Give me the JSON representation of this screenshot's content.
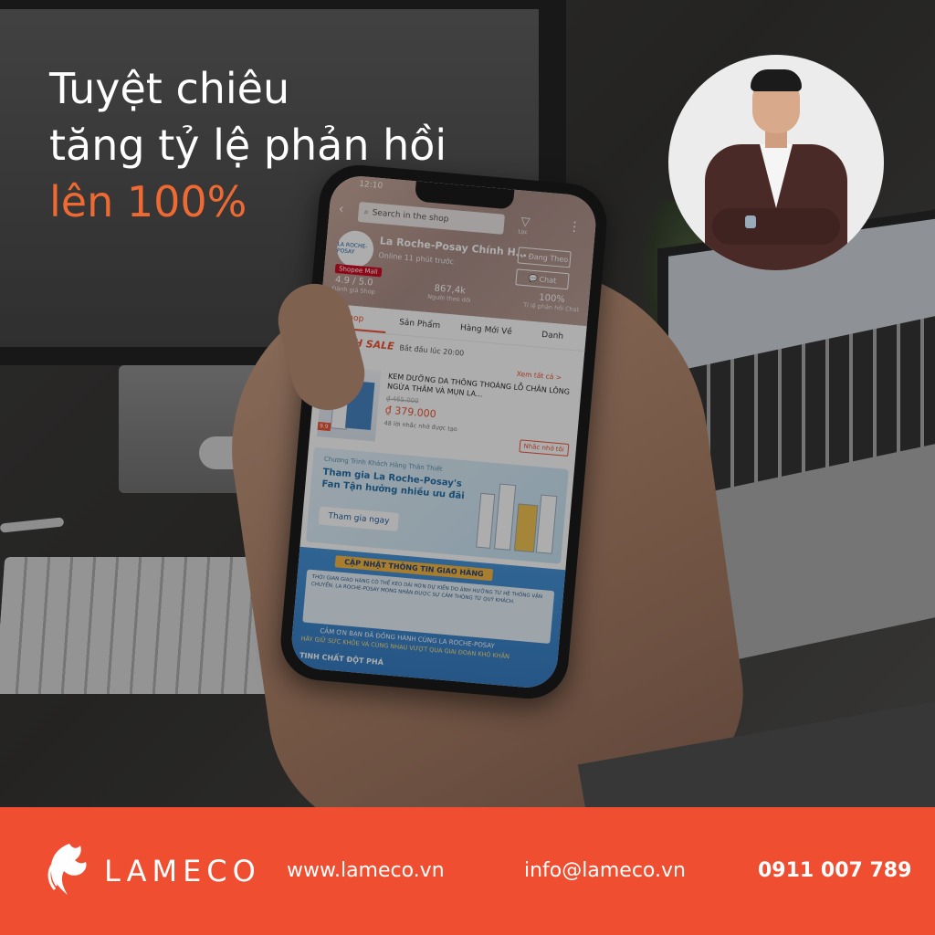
{
  "headline": {
    "line1": "Tuyệt chiêu",
    "line2": "tăng tỷ lệ phản hồi",
    "line3": "lên 100%"
  },
  "phone": {
    "status_time": "12:10",
    "search_placeholder": "Search in the shop",
    "filter_label": "Lọc",
    "shop_logo_text": "LA ROCHE-POSAY",
    "mall_badge": "Shopee Mall",
    "shop_name": "La Roche-Posay Chính H...",
    "online_status": "Online 11 phút trước",
    "follow_label": "Đang Theo",
    "chat_label": "Chat",
    "stats": [
      {
        "value": "4.9 / 5.0",
        "label": "Đánh giá Shop"
      },
      {
        "value": "867,4k",
        "label": "Người theo dõi"
      },
      {
        "value": "100%",
        "label": "Tỉ lệ phản hồi Chat"
      }
    ],
    "tabs": [
      "Shop",
      "Sản Phẩm",
      "Hàng Mới Về",
      "Danh"
    ],
    "flash_sale": "F⚡ASH SALE",
    "flash_time": "Bắt đầu lúc 20:00",
    "see_all": "Xem tất cả >",
    "product": {
      "name": "KEM DƯỠNG DA THÔNG THOÁNG LỖ CHÂN LÔNG NGỪA THÂM VÀ MỤN LA...",
      "old_price": "₫ 465.000",
      "new_price": "₫ 379.000",
      "remind_count": "48 lời nhắc nhở được tạo",
      "remind_button": "Nhắc nhở tôi",
      "sale_tag": "9.9"
    },
    "banner": {
      "small": "Chương Trình Khách Hàng Thân Thiết",
      "title": "Tham gia La Roche-Posay's Fan Tận hưởng nhiều ưu đãi",
      "button": "Tham gia ngay"
    },
    "notice": {
      "title": "CẬP NHẬT THÔNG TIN GIAO HÀNG",
      "body": "THỜI GIAN GIAO HÀNG CÓ THỂ KÉO DÀI HƠN DỰ KIẾN DO ẢNH HƯỞNG TỪ HỆ THỐNG VẬN CHUYỂN. LA ROCHE-POSAY MONG NHẬN ĐƯỢC SỰ CẢM THÔNG TỪ QUÝ KHÁCH.",
      "thanks": "CẢM ƠN BẠN ĐÃ ĐỒNG HÀNH CÙNG LA ROCHE-POSAY",
      "bottom": "HÃY GIỮ SỨC KHỎE VÀ CÙNG NHAU VƯỢT QUA GIAI ĐOẠN KHÓ KHĂN",
      "footer": "TINH CHẤT ĐỘT PHÁ"
    }
  },
  "footer": {
    "brand": "LAMECO",
    "website": "www.lameco.vn",
    "email": "info@lameco.vn",
    "phone": "0911 007 789"
  },
  "colors": {
    "accent": "#ee6a32",
    "footer_bg": "#f04e30",
    "shopee": "#ee4d2d"
  }
}
